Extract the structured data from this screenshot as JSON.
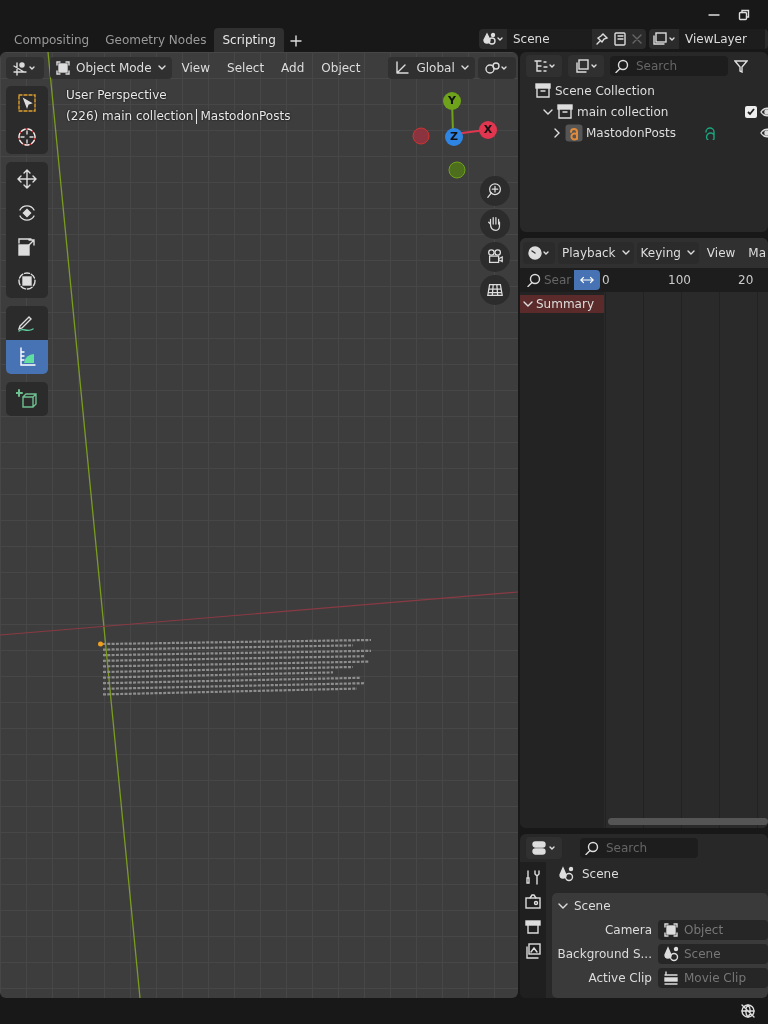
{
  "workspace_tabs": [
    {
      "label": "Compositing",
      "selected": false
    },
    {
      "label": "Geometry Nodes",
      "selected": false
    },
    {
      "label": "Scripting",
      "selected": true
    }
  ],
  "scene_selector": {
    "value": "Scene"
  },
  "view_layer_selector": {
    "value": "ViewLayer"
  },
  "viewport": {
    "header": {
      "mode": "Object Mode",
      "menus": [
        "View",
        "Select",
        "Add",
        "Object"
      ],
      "orientation": "Global"
    },
    "view_name": "User Perspective",
    "context": {
      "collection": "(226) main collection",
      "object": "MastodonPosts"
    },
    "tool_groups": [
      [
        {
          "kind": "select",
          "selected": false
        },
        {
          "kind": "cursor",
          "selected": false
        }
      ],
      [
        {
          "kind": "move",
          "selected": false
        },
        {
          "kind": "rotate",
          "selected": false
        },
        {
          "kind": "scale",
          "selected": false
        },
        {
          "kind": "transform",
          "selected": false
        }
      ],
      [
        {
          "kind": "annotate",
          "selected": false
        },
        {
          "kind": "measure",
          "selected": true
        }
      ],
      [
        {
          "kind": "add-cube",
          "selected": false
        }
      ]
    ],
    "gizmo_axes": [
      {
        "label": "Y",
        "color": "#6ea21a"
      },
      {
        "label": "Z",
        "color": "#2f85e3"
      },
      {
        "label": "X",
        "color": "#e2354f"
      }
    ]
  },
  "outliner": {
    "search": {
      "placeholder": "Search"
    },
    "tree": [
      {
        "label": "Scene Collection",
        "kind": "scene",
        "children": [
          {
            "label": "main collection",
            "kind": "collection",
            "expanded": true,
            "checked": true,
            "children": [
              {
                "label": "MastodonPosts",
                "kind": "text",
                "expanded": false
              }
            ]
          }
        ]
      }
    ]
  },
  "timeline": {
    "menus": [
      "Playback",
      "Keying"
    ],
    "plain_menus": [
      "View",
      "Ma"
    ],
    "search": {
      "placeholder": "Sear"
    },
    "ruler": [
      "0",
      "100",
      "20"
    ],
    "channels": [
      {
        "label": "Summary",
        "expanded": true
      }
    ]
  },
  "properties": {
    "search": {
      "placeholder": "Search"
    },
    "context": "Scene",
    "panel": {
      "title": "Scene",
      "expanded": true,
      "fields": [
        {
          "label": "Camera",
          "kind": "object",
          "placeholder": "Object"
        },
        {
          "label": "Background S...",
          "kind": "scene",
          "placeholder": "Scene"
        },
        {
          "label": "Active Clip",
          "kind": "clip",
          "placeholder": "Movie Clip"
        }
      ]
    }
  }
}
